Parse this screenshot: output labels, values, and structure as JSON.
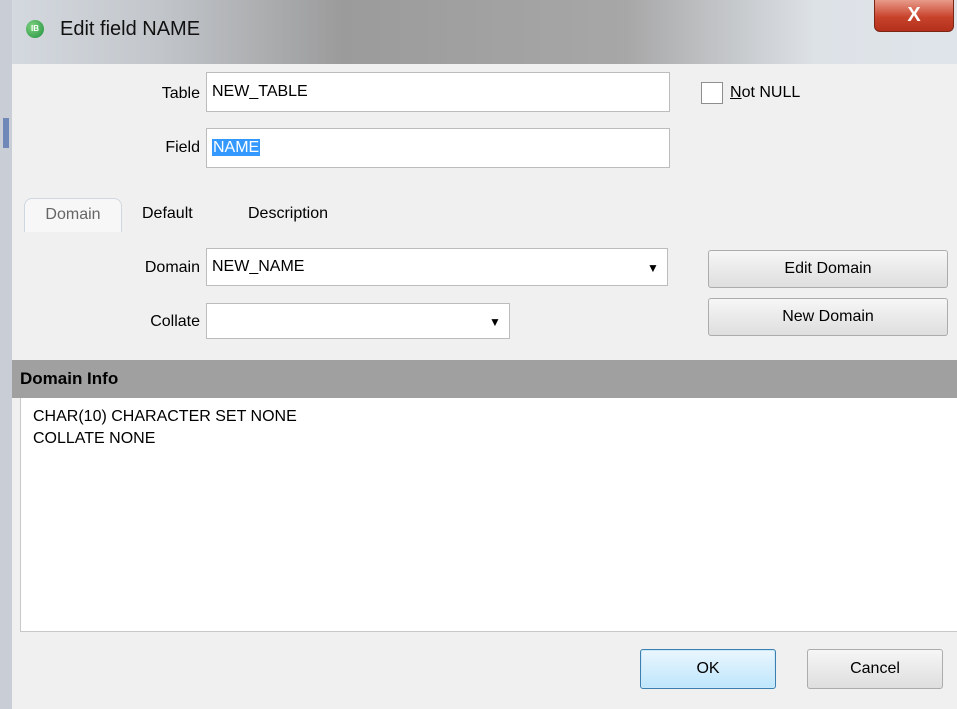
{
  "window": {
    "title": "Edit field NAME",
    "app_icon_text": "IB",
    "close_label": "X"
  },
  "form": {
    "table_label": "Table",
    "table_value": "NEW_TABLE",
    "field_label": "Field",
    "field_value": "NAME",
    "not_null_label": "Not NULL",
    "not_null_checked": false
  },
  "tabs": [
    {
      "label": "Domain",
      "active": true
    },
    {
      "label": "Default",
      "active": false
    },
    {
      "label": "Description",
      "active": false
    }
  ],
  "domain_tab": {
    "domain_label": "Domain",
    "domain_value": "NEW_NAME",
    "collate_label": "Collate",
    "collate_value": "",
    "edit_domain_label": "Edit Domain",
    "new_domain_label": "New Domain"
  },
  "domain_info": {
    "header": "Domain Info",
    "lines": [
      "CHAR(10) CHARACTER SET NONE",
      "COLLATE NONE"
    ]
  },
  "footer": {
    "ok_label": "OK",
    "cancel_label": "Cancel"
  },
  "icons": {
    "app": "interbase-app-icon",
    "close": "close-icon",
    "dropdown": "chevron-down-icon"
  }
}
